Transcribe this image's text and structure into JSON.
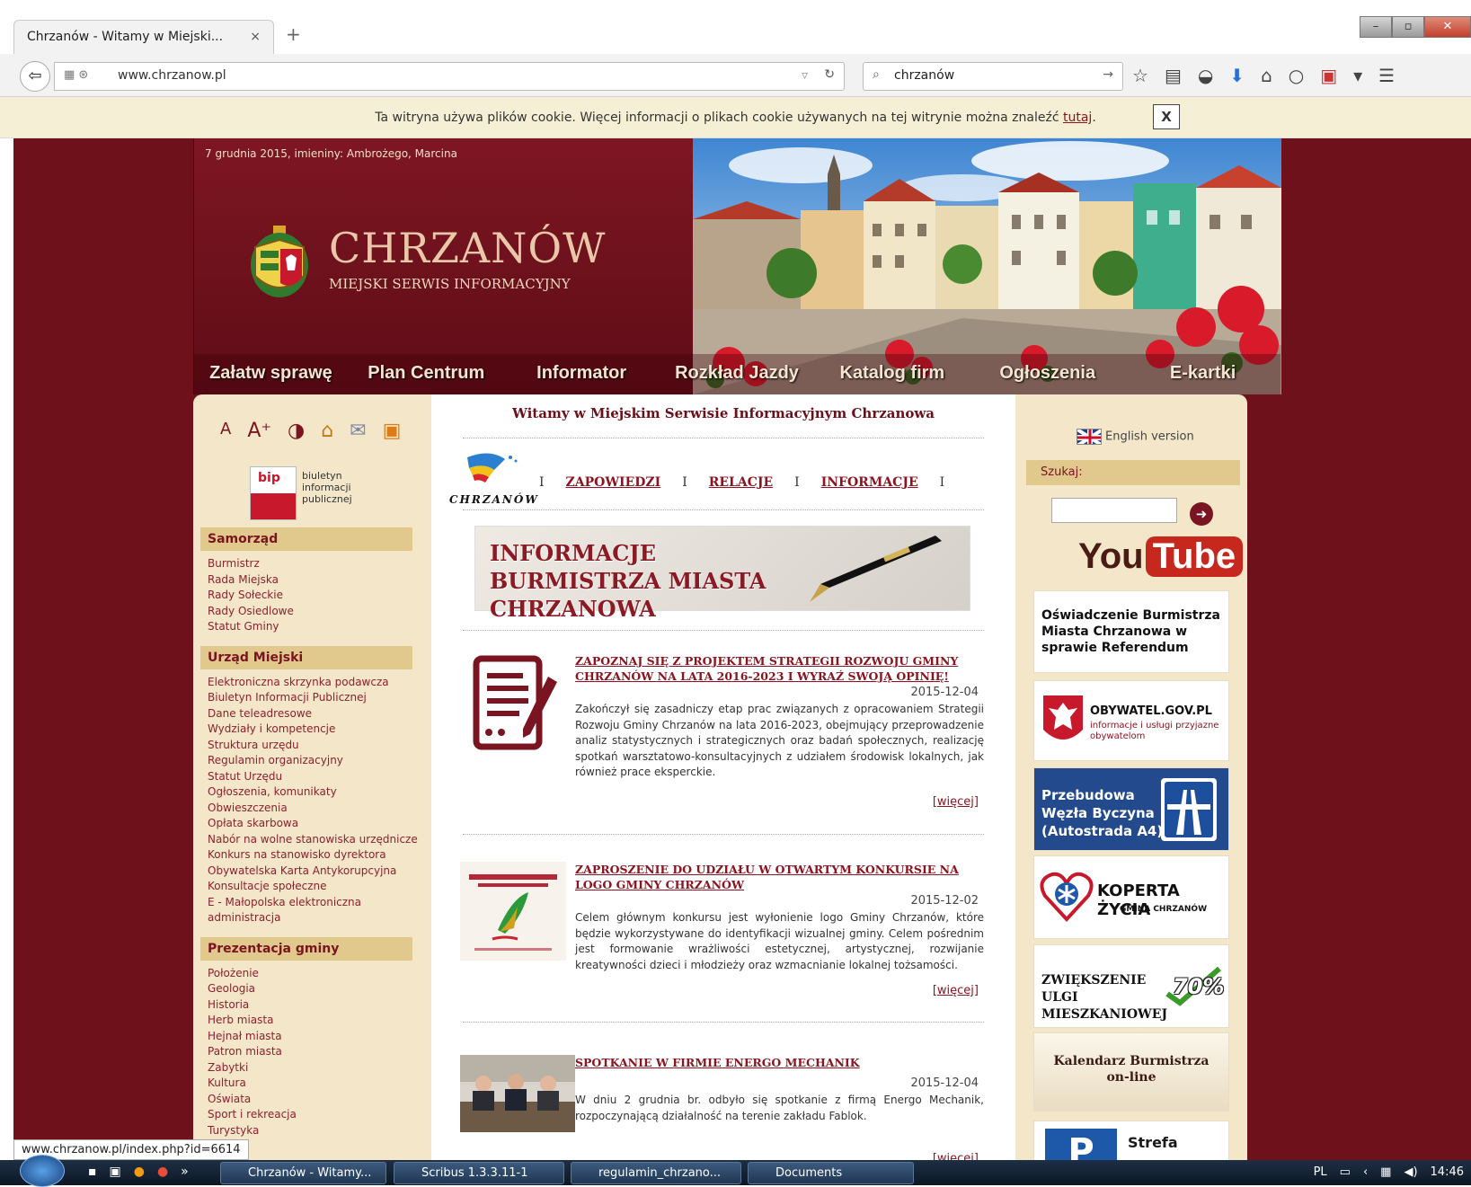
{
  "browser": {
    "tab_title": "Chrzanów - Witamy w Miejski...",
    "tab_close": "×",
    "new_tab": "+",
    "url": "www.chrzanow.pl",
    "search_value": "chrzanów",
    "status_url": "www.chrzanow.pl/index.php?id=6614"
  },
  "cookie_bar": {
    "text": "Ta witryna używa plików cookie. Więcej informacji o plikach cookie używanych na tej witrynie można znaleźć",
    "link": "tutaj",
    "after": ".",
    "close": "X"
  },
  "header": {
    "date_line": "7 grudnia 2015, imieniny: Ambrożego, Marcina",
    "brand_name": "CHRZANÓW",
    "brand_sub": "MIEJSKI SERWIS INFORMACYJNY"
  },
  "main_nav": [
    "Załatw sprawę",
    "Plan Centrum",
    "Informator",
    "Rozkład Jazdy",
    "Katalog firm",
    "Ogłoszenia",
    "E-kartki"
  ],
  "left": {
    "tools": [
      "A",
      "A⁺",
      "◑",
      "⌂",
      "✉",
      "▣"
    ],
    "bip_logo": "bip",
    "bip_text": "biuletyn informacji publicznej",
    "sections": [
      {
        "title": "Samorząd",
        "items": [
          "Burmistrz",
          "Rada Miejska",
          "Rady Sołeckie",
          "Rady Osiedlowe",
          "Statut Gminy"
        ]
      },
      {
        "title": "Urząd Miejski",
        "items": [
          "Elektroniczna skrzynka podawcza",
          "Biuletyn Informacji Publicznej",
          "Dane teleadresowe",
          "Wydziały i kompetencje",
          "Struktura urzędu",
          "Regulamin organizacyjny",
          "Statut Urzędu",
          "Ogłoszenia, komunikaty",
          "Obwieszczenia",
          "Opłata skarbowa",
          "Nabór na wolne stanowiska urzędnicze",
          "Konkurs na stanowisko dyrektora",
          "Obywatelska Karta Antykorupcyjna",
          "Konsultacje społeczne",
          "E - Małopolska elektroniczna",
          "administracja"
        ]
      },
      {
        "title": "Prezentacja gminy",
        "items": [
          "Położenie",
          "Geologia",
          "Historia",
          "Herb miasta",
          "Hejnał miasta",
          "Patron miasta",
          "Zabytki",
          "Kultura",
          "Oświata",
          "Sport i rekreacja",
          "Turystyka"
        ]
      }
    ]
  },
  "center": {
    "welcome": "Witamy w Miejskim Serwisie Informacyjnym Chrzanowa",
    "logo_text": "CHRZANÓW",
    "separator": "I",
    "nav": [
      "ZAPOWIEDZI",
      "RELACJE",
      "INFORMACJE"
    ],
    "banner": "INFORMACJE BURMISTRZA MIASTA CHRZANOWA",
    "more_label": "[więcej]",
    "news": [
      {
        "title": "ZAPOZNAJ SIĘ Z PROJEKTEM STRATEGII ROZWOJU GMINY CHRZANÓW NA LATA 2016-2023 I WYRAŹ SWOJĄ OPINIĘ!",
        "date": "2015-12-04",
        "body": "Zakończył się zasadniczy etap prac związanych z opracowaniem Strategii Rozwoju Gminy Chrzanów na lata 2016-2023, obejmujący przeprowadzenie analiz statystycznych i strategicznych oraz badań społecznych, realizację spotkań warsztatowo-konsultacyjnych z udziałem środowisk lokalnych, jak również prace eksperckie."
      },
      {
        "title": "ZAPROSZENIE DO UDZIAŁU W OTWARTYM KONKURSIE NA LOGO GMINY CHRZANÓW",
        "date": "2015-12-02",
        "body": "Celem głównym konkursu jest wyłonienie logo Gminy Chrzanów, które będzie wykorzystywane do identyfikacji wizualnej gminy. Celem pośrednim jest formowanie wrażliwości estetycznej, artystycznej, rozwijanie kreatywności dzieci i młodzieży oraz wzmacnianie lokalnej tożsamości."
      },
      {
        "title": "SPOTKANIE W FIRMIE ENERGO MECHANIK",
        "date": "2015-12-04",
        "body": "W dniu 2 grudnia br. odbyło się spotkanie z firmą Energo Mechanik, rozpoczynającą działalność na terenie zakładu Fablok."
      }
    ]
  },
  "right": {
    "english": "English version",
    "search_label": "Szukaj:",
    "search_go": "➜",
    "youtube_a": "You",
    "youtube_b": "Tube",
    "box1": "Oświadczenie Burmistrza Miasta Chrzanowa w sprawie Referendum",
    "box2_title": "OBYWATEL.GOV.PL",
    "box2_sub": "informacje i usługi przyjazne obywatelom",
    "box3": "Przebudowa Węzła Byczyna (Autostrada A4)",
    "box4_title": "KOPERTA ŻYCIA",
    "box4_sub": "GMINA CHRZANÓW",
    "box5_title": "ZWIĘKSZENIE ULGI MIESZKANIOWEJ",
    "box5_pct": "70%",
    "box6": "Kalendarz Burmistrza on-line",
    "box7": "Strefa"
  },
  "taskbar": {
    "items": [
      "Chrzanów - Witamy...",
      "Scribus 1.3.3.11-1",
      "regulamin_chrzano...",
      "Documents"
    ],
    "lang": "PL",
    "time": "14:46"
  },
  "colors": {
    "site_bg": "#6e111b",
    "panel": "#f3e6c9",
    "accent": "#8b1420"
  }
}
